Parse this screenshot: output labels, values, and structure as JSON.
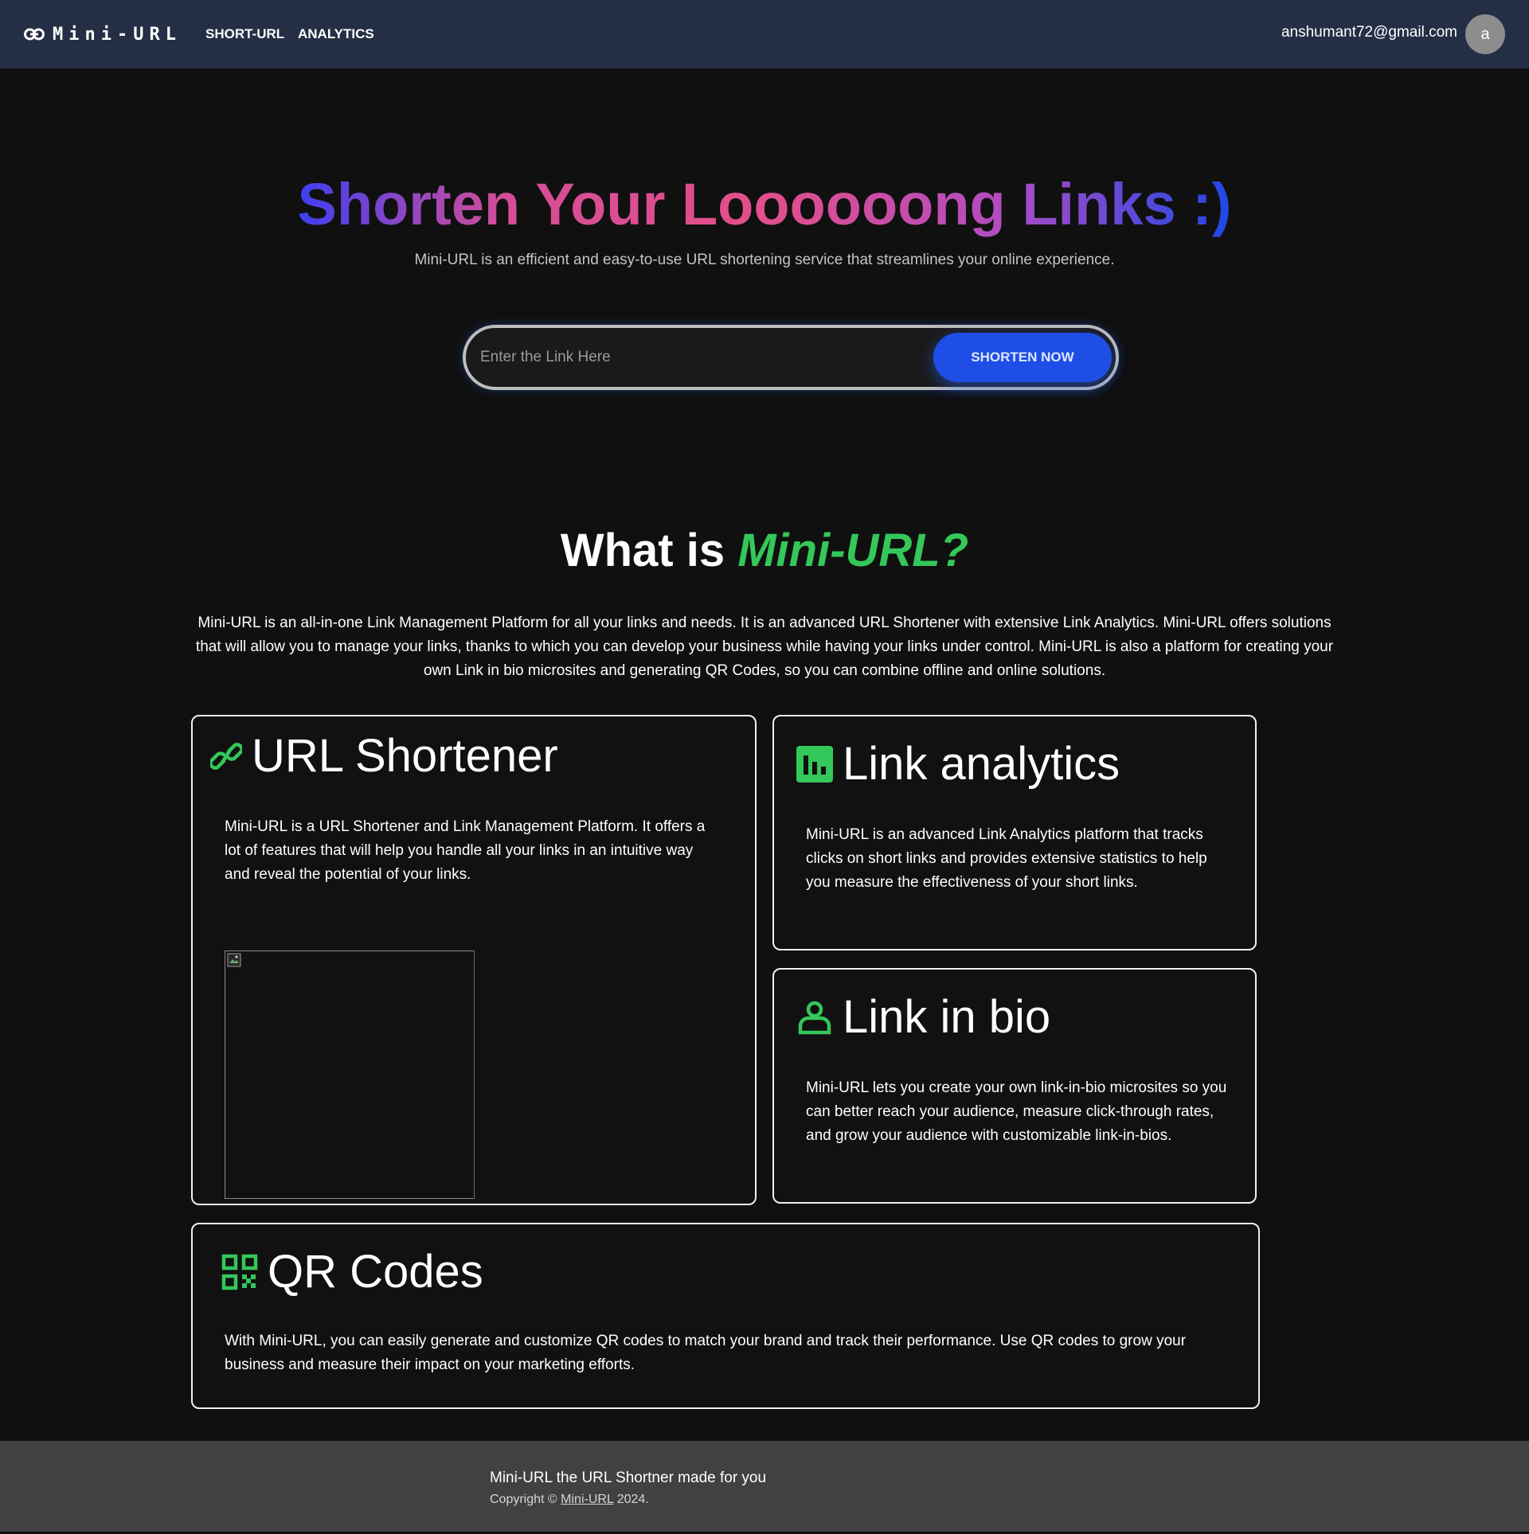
{
  "navbar": {
    "brand_icon": "link-icon",
    "brand": "Mini-URL",
    "links": [
      {
        "label": "SHORT-URL"
      },
      {
        "label": "ANALYTICS"
      }
    ],
    "user_email": "anshumant72@gmail.com",
    "avatar_initial": "a"
  },
  "hero": {
    "title": "Shorten Your Loooooong Links :)",
    "subtitle": "Mini-URL is an efficient and easy-to-use URL shortening service that streamlines your online experience.",
    "input_placeholder": "Enter the Link Here",
    "input_value": "",
    "button_label": "SHORTEN NOW"
  },
  "about": {
    "title_prefix": "What is",
    "title_accent": "Mini-URL?",
    "description": "Mini-URL is an all-in-one Link Management Platform for all your links and needs. It is an advanced URL Shortener with extensive Link Analytics. Mini-URL offers solutions that will allow you to manage your links, thanks to which you can develop your business while having your links under control. Mini-URL is also a platform for creating your own Link in bio microsites and generating QR Codes, so you can combine offline and online solutions."
  },
  "cards": {
    "url_shortener": {
      "icon": "link-chain-icon",
      "title": "URL Shortener",
      "text": "Mini-URL is a URL Shortener and Link Management Platform. It offers a lot of features that will help you handle all your links in an intuitive way and reveal the potential of your links."
    },
    "analytics": {
      "icon": "bar-chart-icon",
      "title": "Link analytics",
      "text": "Mini-URL is an advanced Link Analytics platform that tracks clicks on short links and provides extensive statistics to help you measure the effectiveness of your short links."
    },
    "bio": {
      "icon": "user-icon",
      "title": "Link in bio",
      "text": "Mini-URL lets you create your own link-in-bio microsites so you can better reach your audience, measure click-through rates, and grow your audience with customizable link-in-bios."
    },
    "qr": {
      "icon": "qr-code-icon",
      "title": "QR Codes",
      "text": "With Mini-URL, you can easily generate and customize QR codes to match your brand and track their performance. Use QR codes to grow your business and measure their impact on your marketing efforts."
    }
  },
  "footer": {
    "tagline": "Mini-URL the URL Shortner made for you",
    "copyright_prefix": "Copyright ©",
    "copyright_link": "Mini-URL",
    "copyright_year": "2024."
  },
  "colors": {
    "navbar_bg": "#242f45",
    "page_bg": "#101010",
    "accent_green": "#34c759",
    "button_blue": "#1f4ee6",
    "footer_bg": "#414141"
  }
}
